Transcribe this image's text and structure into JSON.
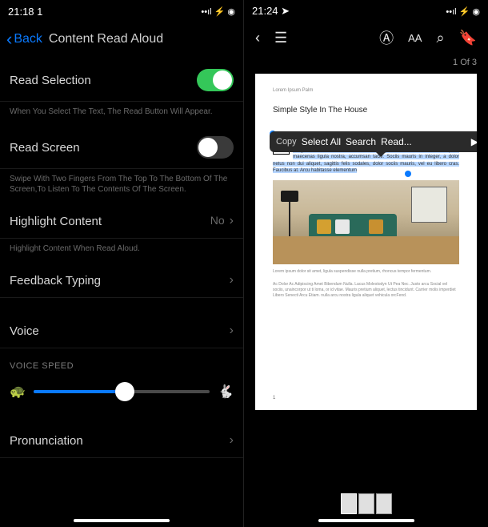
{
  "left": {
    "status": {
      "time": "21:18 1",
      "icons": "••ıl ⚡ ◉"
    },
    "nav": {
      "back": "Back",
      "title": "Content Read Aloud"
    },
    "readSelection": {
      "label": "Read Selection",
      "on": true,
      "desc": "When You Select The Text, The Read Button Will Appear."
    },
    "readScreen": {
      "label": "Read Screen",
      "on": false,
      "desc": "Swipe With Two Fingers From The Top To The Bottom Of The Screen,To Listen To The Contents Of The Screen."
    },
    "highlight": {
      "label": "Highlight Content",
      "value": "No",
      "desc": "Highlight Content When Read Aloud."
    },
    "feedback": {
      "label": "Feedback Typing"
    },
    "voice": {
      "label": "Voice"
    },
    "speed": {
      "header": "VOICE SPEED",
      "pct": 52
    },
    "pronunciation": {
      "label": "Pronunciation"
    }
  },
  "right": {
    "status": {
      "time": "21:24 ➤",
      "icons": "••ıl ⚡ ◉"
    },
    "pageCount": "1 Of 3",
    "popup": {
      "copy": "Copy",
      "selectAll": "Select All",
      "search": "Search",
      "read": "Read..."
    },
    "doc": {
      "header": "Lorem Ipsum Palm",
      "title": "Simple Style In The House",
      "para1": "orem ipsum dolor sit amet, ligula suspendisse nulla pretium, rhoncus tempor fermentum, enim integer ad vestibulum volutpat. Nisl turpis est, vel elit, congue wisi enim nunc ultricies sit, magna tincidunt. Maecenas aliquam maecenas ligula nostra, accumsan taciti. Sociis mauris in integer, a dolor netus non dui aliquet, sagittis felis sodales, dolor sociis mauris, vel eu libero cras. Faucibus at. Arcu habitasse elementum",
      "caption": "Lorem ipsum dolor sit amet, ligula suspendisse nulla pretium, rhoncus tempor fermentum.",
      "para2": "Ac Dolor Ac Adipiscing Amet Bibendum Nulla. Lacus Molestodyn Ut Pea Nec. Justo arcu Social vel sociis, unaincorpor ut ti loma, or id vitae. Mauris pretium aliquet, lectus tincidunt. Carrier molis imperdiet Libero Senecti Arcu Etiam. nulla arcu nostra ligula aliquet vehicula orcFend.",
      "pageNum": "1"
    }
  }
}
